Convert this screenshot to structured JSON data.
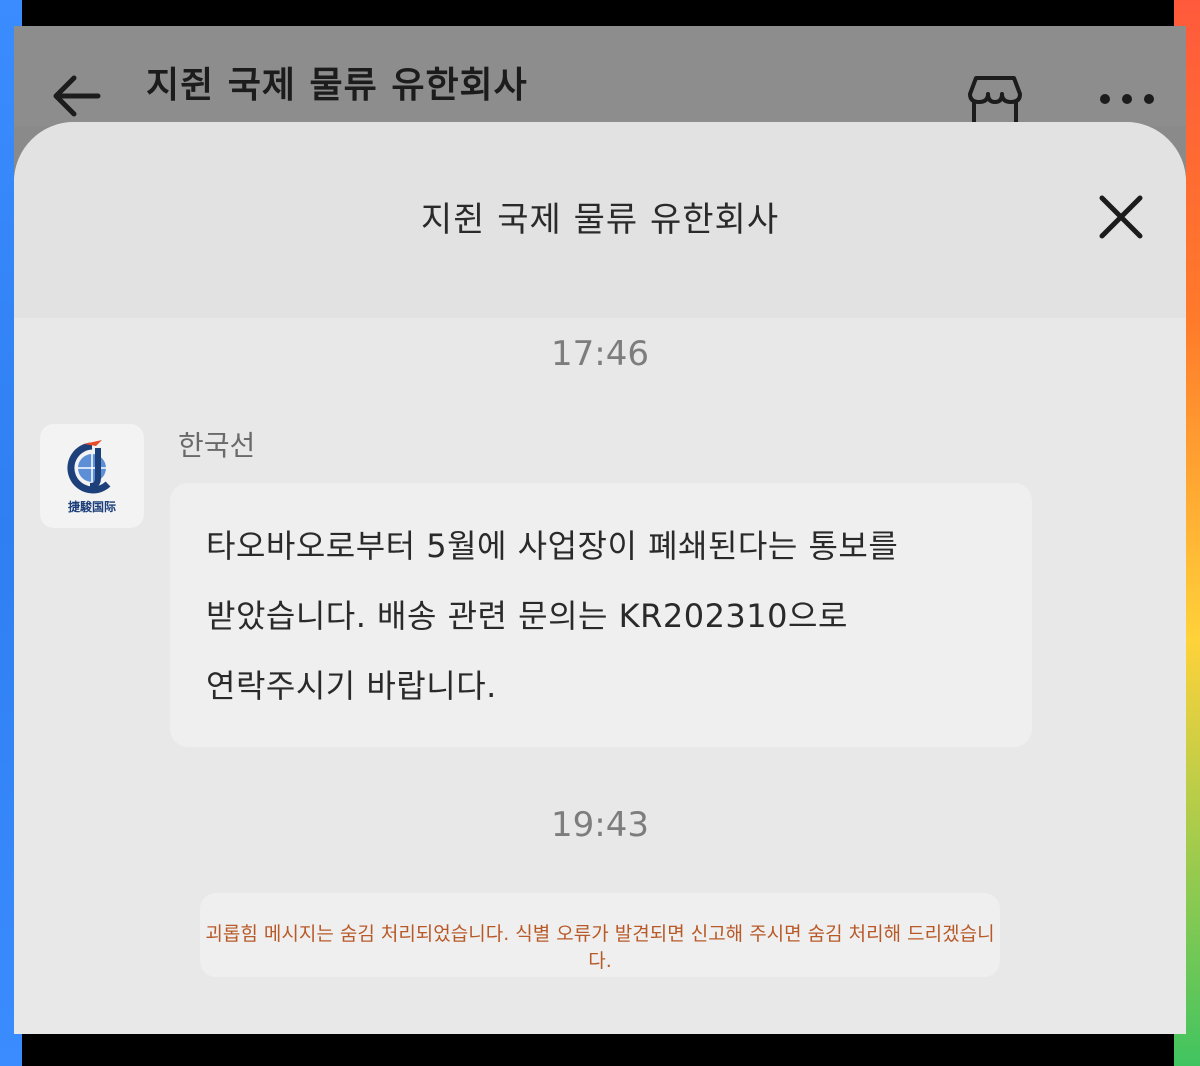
{
  "app_header": {
    "title": "지쥔 국제 물류 유한회사",
    "back_icon": "back-arrow-icon",
    "shop_icon": "store-icon",
    "more_icon": "more-dots-icon"
  },
  "sheet": {
    "title": "지쥔 국제 물류 유한회사",
    "close_icon": "close-icon"
  },
  "chat": {
    "timestamp_1": "17:46",
    "sender_name": "한국선",
    "avatar_text": "捷駿国际",
    "message_lines": [
      "타오바오로부터 5월에 사업장이 폐쇄된다는 통보를",
      "받았습니다. 배송 관련 문의는 KR202310으로",
      "연락주시기 바랍니다."
    ],
    "timestamp_2": "19:43",
    "notice": "괴롭힘 메시지는 숨김 처리되었습니다. 식별 오류가 발견되면 신고해 주시면 숨김 처리해 드리겠습니다."
  },
  "colors": {
    "notice_text": "#b85a28",
    "sheet_bg": "#e8e8e9",
    "bubble_bg": "#efeff0",
    "edge_left": "#3b8cff",
    "edge_right_top": "#ff5a3c",
    "edge_right_bottom": "#40c460"
  }
}
